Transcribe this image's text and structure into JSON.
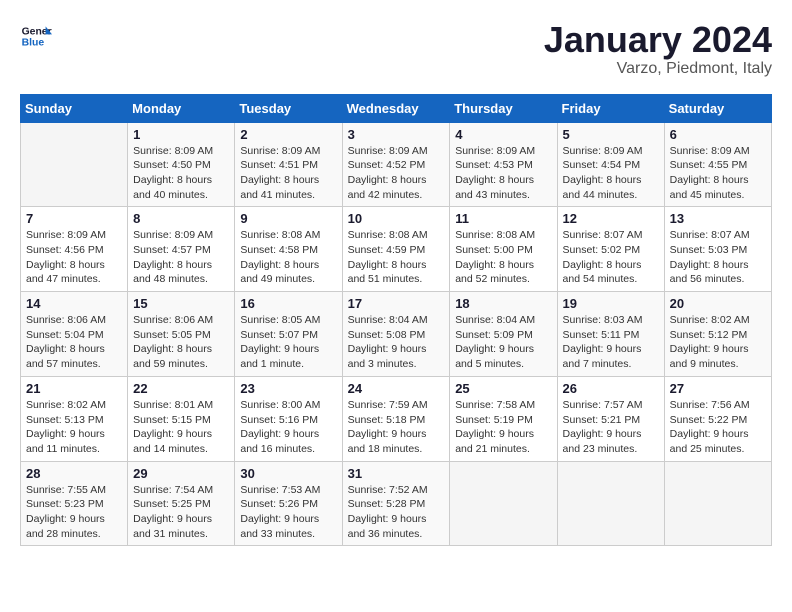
{
  "header": {
    "logo_general": "General",
    "logo_blue": "Blue",
    "month_title": "January 2024",
    "subtitle": "Varzo, Piedmont, Italy"
  },
  "days_of_week": [
    "Sunday",
    "Monday",
    "Tuesday",
    "Wednesday",
    "Thursday",
    "Friday",
    "Saturday"
  ],
  "weeks": [
    [
      {
        "day": "",
        "info": ""
      },
      {
        "day": "1",
        "info": "Sunrise: 8:09 AM\nSunset: 4:50 PM\nDaylight: 8 hours\nand 40 minutes."
      },
      {
        "day": "2",
        "info": "Sunrise: 8:09 AM\nSunset: 4:51 PM\nDaylight: 8 hours\nand 41 minutes."
      },
      {
        "day": "3",
        "info": "Sunrise: 8:09 AM\nSunset: 4:52 PM\nDaylight: 8 hours\nand 42 minutes."
      },
      {
        "day": "4",
        "info": "Sunrise: 8:09 AM\nSunset: 4:53 PM\nDaylight: 8 hours\nand 43 minutes."
      },
      {
        "day": "5",
        "info": "Sunrise: 8:09 AM\nSunset: 4:54 PM\nDaylight: 8 hours\nand 44 minutes."
      },
      {
        "day": "6",
        "info": "Sunrise: 8:09 AM\nSunset: 4:55 PM\nDaylight: 8 hours\nand 45 minutes."
      }
    ],
    [
      {
        "day": "7",
        "info": "Sunrise: 8:09 AM\nSunset: 4:56 PM\nDaylight: 8 hours\nand 47 minutes."
      },
      {
        "day": "8",
        "info": "Sunrise: 8:09 AM\nSunset: 4:57 PM\nDaylight: 8 hours\nand 48 minutes."
      },
      {
        "day": "9",
        "info": "Sunrise: 8:08 AM\nSunset: 4:58 PM\nDaylight: 8 hours\nand 49 minutes."
      },
      {
        "day": "10",
        "info": "Sunrise: 8:08 AM\nSunset: 4:59 PM\nDaylight: 8 hours\nand 51 minutes."
      },
      {
        "day": "11",
        "info": "Sunrise: 8:08 AM\nSunset: 5:00 PM\nDaylight: 8 hours\nand 52 minutes."
      },
      {
        "day": "12",
        "info": "Sunrise: 8:07 AM\nSunset: 5:02 PM\nDaylight: 8 hours\nand 54 minutes."
      },
      {
        "day": "13",
        "info": "Sunrise: 8:07 AM\nSunset: 5:03 PM\nDaylight: 8 hours\nand 56 minutes."
      }
    ],
    [
      {
        "day": "14",
        "info": "Sunrise: 8:06 AM\nSunset: 5:04 PM\nDaylight: 8 hours\nand 57 minutes."
      },
      {
        "day": "15",
        "info": "Sunrise: 8:06 AM\nSunset: 5:05 PM\nDaylight: 8 hours\nand 59 minutes."
      },
      {
        "day": "16",
        "info": "Sunrise: 8:05 AM\nSunset: 5:07 PM\nDaylight: 9 hours\nand 1 minute."
      },
      {
        "day": "17",
        "info": "Sunrise: 8:04 AM\nSunset: 5:08 PM\nDaylight: 9 hours\nand 3 minutes."
      },
      {
        "day": "18",
        "info": "Sunrise: 8:04 AM\nSunset: 5:09 PM\nDaylight: 9 hours\nand 5 minutes."
      },
      {
        "day": "19",
        "info": "Sunrise: 8:03 AM\nSunset: 5:11 PM\nDaylight: 9 hours\nand 7 minutes."
      },
      {
        "day": "20",
        "info": "Sunrise: 8:02 AM\nSunset: 5:12 PM\nDaylight: 9 hours\nand 9 minutes."
      }
    ],
    [
      {
        "day": "21",
        "info": "Sunrise: 8:02 AM\nSunset: 5:13 PM\nDaylight: 9 hours\nand 11 minutes."
      },
      {
        "day": "22",
        "info": "Sunrise: 8:01 AM\nSunset: 5:15 PM\nDaylight: 9 hours\nand 14 minutes."
      },
      {
        "day": "23",
        "info": "Sunrise: 8:00 AM\nSunset: 5:16 PM\nDaylight: 9 hours\nand 16 minutes."
      },
      {
        "day": "24",
        "info": "Sunrise: 7:59 AM\nSunset: 5:18 PM\nDaylight: 9 hours\nand 18 minutes."
      },
      {
        "day": "25",
        "info": "Sunrise: 7:58 AM\nSunset: 5:19 PM\nDaylight: 9 hours\nand 21 minutes."
      },
      {
        "day": "26",
        "info": "Sunrise: 7:57 AM\nSunset: 5:21 PM\nDaylight: 9 hours\nand 23 minutes."
      },
      {
        "day": "27",
        "info": "Sunrise: 7:56 AM\nSunset: 5:22 PM\nDaylight: 9 hours\nand 25 minutes."
      }
    ],
    [
      {
        "day": "28",
        "info": "Sunrise: 7:55 AM\nSunset: 5:23 PM\nDaylight: 9 hours\nand 28 minutes."
      },
      {
        "day": "29",
        "info": "Sunrise: 7:54 AM\nSunset: 5:25 PM\nDaylight: 9 hours\nand 31 minutes."
      },
      {
        "day": "30",
        "info": "Sunrise: 7:53 AM\nSunset: 5:26 PM\nDaylight: 9 hours\nand 33 minutes."
      },
      {
        "day": "31",
        "info": "Sunrise: 7:52 AM\nSunset: 5:28 PM\nDaylight: 9 hours\nand 36 minutes."
      },
      {
        "day": "",
        "info": ""
      },
      {
        "day": "",
        "info": ""
      },
      {
        "day": "",
        "info": ""
      }
    ]
  ]
}
